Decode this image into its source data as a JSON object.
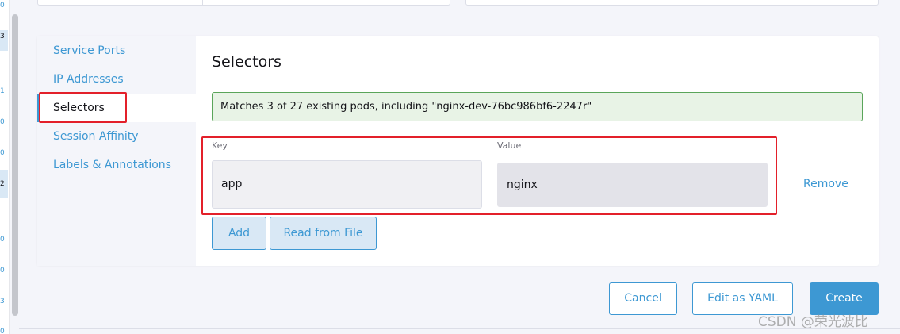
{
  "gutter": {
    "digits": [
      "0",
      "3",
      "1",
      "0",
      "0",
      "2",
      "0",
      "0",
      "3",
      "0"
    ]
  },
  "tabs": [
    {
      "label": "Service Ports"
    },
    {
      "label": "IP Addresses"
    },
    {
      "label": "Selectors"
    },
    {
      "label": "Session Affinity"
    },
    {
      "label": "Labels & Annotations"
    }
  ],
  "selectors": {
    "title": "Selectors",
    "match_text": "Matches 3 of 27 existing pods, including \"nginx-dev-76bc986bf6-2247r\"",
    "key_label": "Key",
    "value_label": "Value",
    "key_value": "app",
    "value_value": "nginx",
    "remove_label": "Remove",
    "add_label": "Add",
    "read_from_file_label": "Read from File"
  },
  "footer": {
    "cancel_label": "Cancel",
    "edit_yaml_label": "Edit as YAML",
    "create_label": "Create"
  },
  "watermark": "CSDN @荣光波比",
  "colors": {
    "accent": "#3d98d3",
    "highlight_border": "#e3202a",
    "success_bg": "#e8f3e6",
    "success_border": "#5aa55a"
  }
}
